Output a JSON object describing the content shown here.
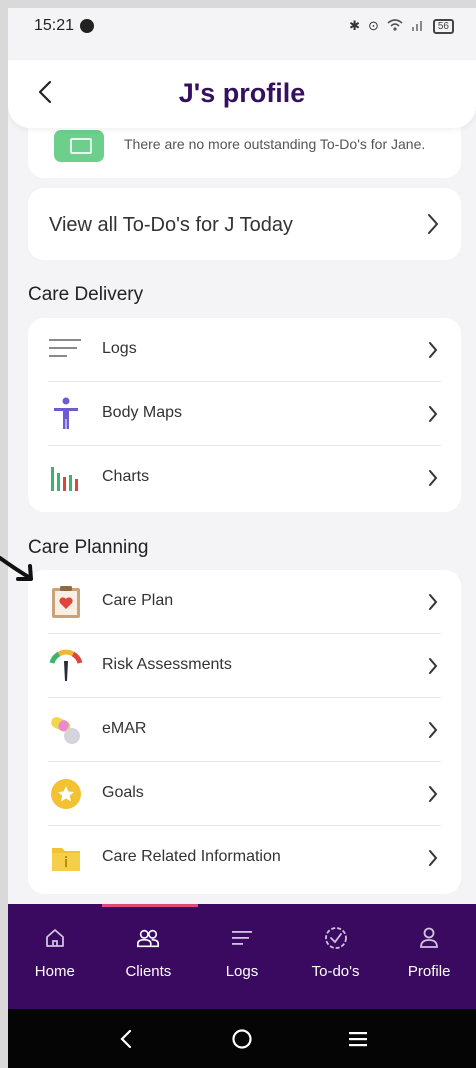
{
  "status_bar": {
    "time": "15:21",
    "battery": "56"
  },
  "header": {
    "title": "J's profile"
  },
  "notice": {
    "text": "There are no more outstanding To-Do's for Jane."
  },
  "todos": {
    "label": "View all To-Do's for J Today"
  },
  "care_delivery": {
    "title": "Care Delivery",
    "items": [
      {
        "label": "Logs",
        "icon": "lines-icon"
      },
      {
        "label": "Body Maps",
        "icon": "body-figure-icon"
      },
      {
        "label": "Charts",
        "icon": "bar-chart-icon"
      }
    ]
  },
  "care_planning": {
    "title": "Care Planning",
    "items": [
      {
        "label": "Care Plan",
        "icon": "clipboard-heart-icon"
      },
      {
        "label": "Risk Assessments",
        "icon": "gauge-icon"
      },
      {
        "label": "eMAR",
        "icon": "pills-icon"
      },
      {
        "label": "Goals",
        "icon": "star-badge-icon"
      },
      {
        "label": "Care Related Information",
        "icon": "folder-info-icon"
      }
    ]
  },
  "bottom_nav": {
    "active": "Clients",
    "items": [
      {
        "label": "Home",
        "icon": "home-icon"
      },
      {
        "label": "Clients",
        "icon": "clients-icon"
      },
      {
        "label": "Logs",
        "icon": "logs-icon"
      },
      {
        "label": "To-do's",
        "icon": "todo-check-icon"
      },
      {
        "label": "Profile",
        "icon": "profile-icon"
      }
    ]
  },
  "colors": {
    "brand_purple": "#3a0a60",
    "title_purple": "#35105f",
    "active_indicator": "#e2467c"
  }
}
